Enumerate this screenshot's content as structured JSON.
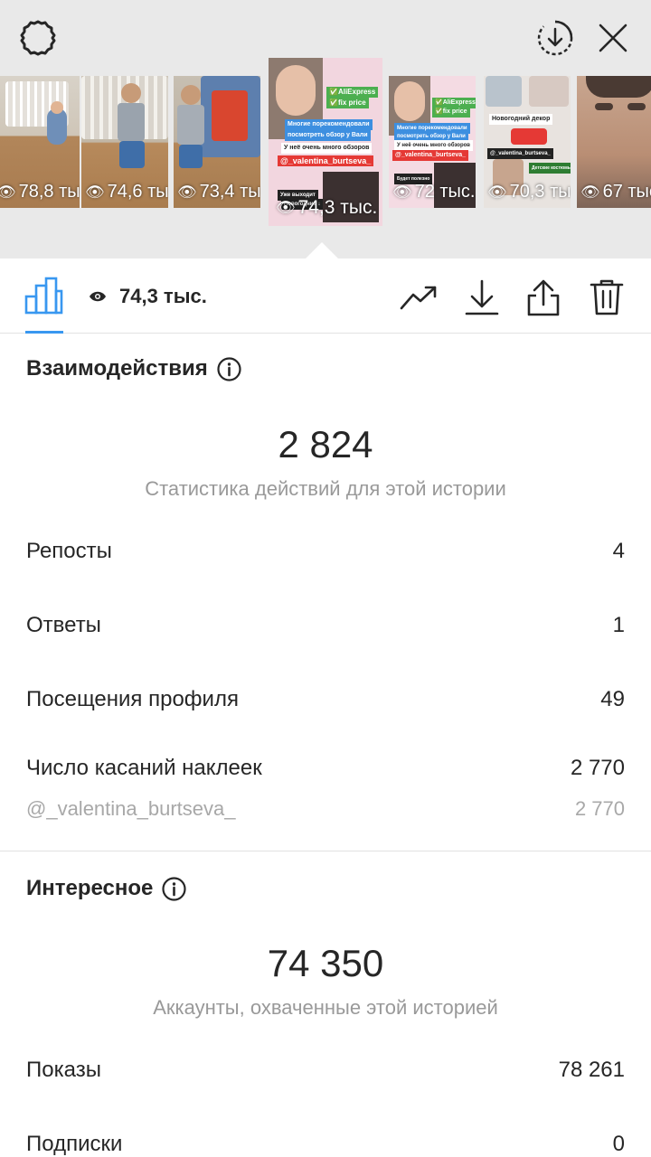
{
  "stories": [
    {
      "views": "78,8 тыс."
    },
    {
      "views": "74,6 тыс."
    },
    {
      "views": "73,4 тыс."
    },
    {
      "views": "74,3 тыс.",
      "selected": true,
      "stickers": [
        "✅AliExpress",
        "✅fix price",
        "Многие порекомендовали",
        "посмотреть обзор у Вали",
        "У неё очень много обзоров",
        "@_valentina_burtseva_",
        "Уже выходит",
        "Новогодние ↓"
      ]
    },
    {
      "views": "72 тыс.",
      "stickers": [
        "✅AliExpress",
        "✅fix price",
        "Многие порекомендовали",
        "посмотреть обзор у Вали",
        "У неё очень много обзоров",
        "@_valentina_burtseva_",
        "Будет полезно"
      ]
    },
    {
      "views": "70,3 тыс.",
      "stickers": [
        "Новогодний декор",
        "@_valentina_burtseva_",
        "Детские костюмы"
      ]
    },
    {
      "views": "67 тыс."
    }
  ],
  "toolbar": {
    "view_count": "74,3 тыс."
  },
  "interactions": {
    "title": "Взаимодействия",
    "total": "2 824",
    "caption": "Статистика действий для этой истории",
    "rows": [
      {
        "label": "Репосты",
        "value": "4"
      },
      {
        "label": "Ответы",
        "value": "1"
      },
      {
        "label": "Посещения профиля",
        "value": "49"
      },
      {
        "label": "Число касаний наклеек",
        "value": "2 770"
      }
    ],
    "sticker_row": {
      "label": "@_valentina_burtseva_",
      "value": "2 770"
    }
  },
  "discovery": {
    "title": "Интересное",
    "total": "74 350",
    "caption": "Аккаунты, охваченные этой историей",
    "rows": [
      {
        "label": "Показы",
        "value": "78 261"
      },
      {
        "label": "Подписки",
        "value": "0"
      }
    ]
  },
  "colors": {
    "accent": "#3897f0",
    "top_background": "#e9e9e9",
    "muted_text": "#999999"
  }
}
